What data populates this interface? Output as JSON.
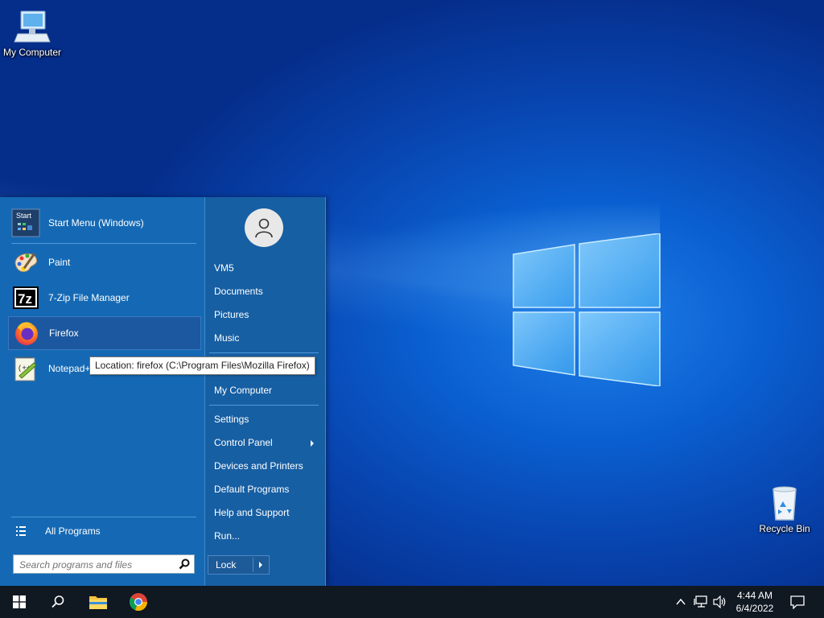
{
  "desktop": {
    "icons": [
      {
        "label": "My Computer",
        "icon": "computer-icon"
      },
      {
        "label": "Recycle Bin",
        "icon": "recycle-bin-icon"
      }
    ]
  },
  "start_menu": {
    "pinned": [
      {
        "label": "Start Menu (Windows)",
        "icon": "start-menu-icon"
      },
      {
        "label": "Paint",
        "icon": "paint-icon"
      },
      {
        "label": "7-Zip File Manager",
        "icon": "7zip-icon"
      },
      {
        "label": "Firefox",
        "icon": "firefox-icon",
        "highlighted": true
      },
      {
        "label": "Notepad++",
        "icon": "notepadpp-icon"
      }
    ],
    "tooltip": "Location: firefox (C:\\Program Files\\Mozilla Firefox)",
    "all_programs": "All Programs",
    "search_placeholder": "Search programs and files",
    "right": {
      "user": "VM5",
      "documents": "Documents",
      "pictures": "Pictures",
      "music": "Music",
      "my_computer": "My Computer",
      "settings": "Settings",
      "control_panel": "Control Panel",
      "devices": "Devices and Printers",
      "default_programs": "Default Programs",
      "help": "Help and Support",
      "run": "Run..."
    },
    "lock": "Lock"
  },
  "taskbar": {
    "time": "4:44 AM",
    "date": "6/4/2022"
  },
  "colors": {
    "menu_bg": "#1569b4",
    "taskbar_bg": "#101822",
    "desktop_accent": "#0a5fd0"
  }
}
